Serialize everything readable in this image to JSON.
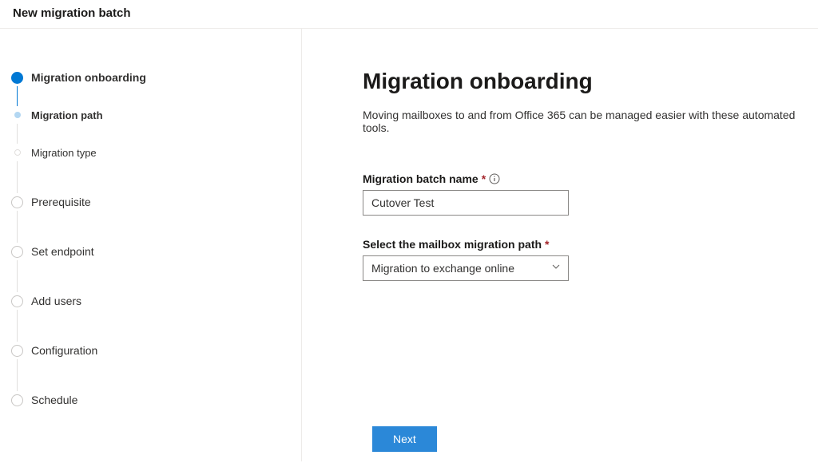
{
  "header": {
    "title": "New migration batch"
  },
  "sidebar": {
    "steps": [
      {
        "label": "Migration onboarding",
        "state": "active"
      },
      {
        "label": "Migration path",
        "state": "sub-active"
      },
      {
        "label": "Migration type",
        "state": "sub-inactive"
      },
      {
        "label": "Prerequisite",
        "state": "pending"
      },
      {
        "label": "Set endpoint",
        "state": "pending"
      },
      {
        "label": "Add users",
        "state": "pending"
      },
      {
        "label": "Configuration",
        "state": "pending"
      },
      {
        "label": "Schedule",
        "state": "pending"
      }
    ]
  },
  "main": {
    "title": "Migration onboarding",
    "description": "Moving mailboxes to and from Office 365 can be managed easier with these automated tools.",
    "batchNameLabel": "Migration batch name",
    "batchNameValue": "Cutover Test",
    "pathLabel": "Select the mailbox migration path",
    "pathValue": "Migration to exchange online"
  },
  "footer": {
    "next": "Next"
  },
  "symbols": {
    "required": "*"
  }
}
